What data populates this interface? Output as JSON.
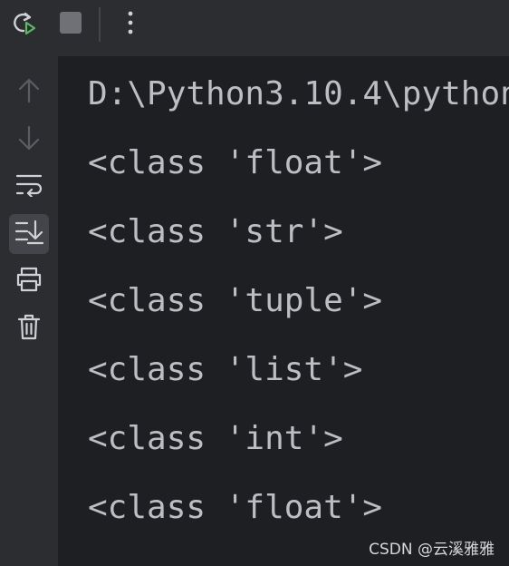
{
  "toolbar": {
    "buttons": [
      {
        "name": "rerun-icon",
        "color": "#5fb865"
      },
      {
        "name": "stop-icon",
        "color": "#6f7177"
      },
      {
        "name": "more-options-icon",
        "color": "#cfd1d6"
      }
    ]
  },
  "gutter": {
    "buttons": [
      {
        "name": "arrow-up-icon",
        "active": false
      },
      {
        "name": "arrow-down-icon",
        "active": false
      },
      {
        "name": "soft-wrap-icon",
        "active": false
      },
      {
        "name": "scroll-to-end-icon",
        "active": true
      },
      {
        "name": "print-icon",
        "active": false
      },
      {
        "name": "trash-icon",
        "active": false
      }
    ]
  },
  "console": {
    "lines": [
      "D:\\Python3.10.4\\python",
      "<class 'float'>",
      "<class 'str'>",
      "<class 'tuple'>",
      "<class 'list'>",
      "<class 'int'>",
      "<class 'float'>"
    ]
  },
  "watermark": "CSDN @云溪雅雅",
  "colors": {
    "background": "#1e1f22",
    "panel": "#2b2d30",
    "text": "#bcbec4",
    "accent_green": "#5fb865"
  }
}
